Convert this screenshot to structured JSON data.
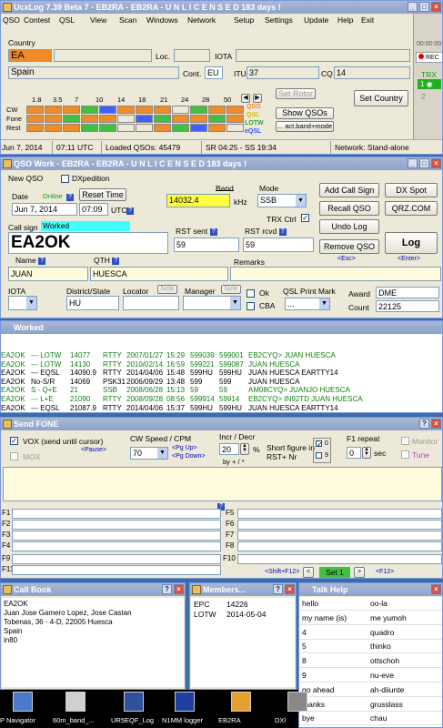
{
  "main": {
    "title": "UcxLog 7.39 Beta 7 - EB2RA - EB2RA - U N L I C E N S E D  183 days !",
    "menu": [
      "QSO",
      "Contest",
      "QSL",
      "View",
      "Scan",
      "Windows",
      "Network",
      "Setup",
      "Settings",
      "Update",
      "Help",
      "Exit"
    ],
    "country_label": "Country",
    "prefix": "EA",
    "country": "Spain",
    "loc_label": "Loc.",
    "iota_label": "IOTA",
    "cont_label": "Cont.",
    "cont": "EU",
    "itu_label": "ITU",
    "itu": "37",
    "cq_label": "CQ",
    "cq": "14",
    "bands": [
      "1.8",
      "3.5",
      "7",
      "10",
      "14",
      "18",
      "21",
      "24",
      "28",
      "50"
    ],
    "modes": [
      "CW",
      "Fone",
      "Rest"
    ],
    "legend": [
      "QSO",
      "QSL",
      "LOTW",
      "eQSL"
    ],
    "set_rotor": "Set Rotor",
    "show_qsos": "Show QSOs",
    "act_band_mode": "... act.band+mode",
    "set_country": "Set Country",
    "rec": "REC",
    "clock": "00:00:00",
    "trx_label": "TRX",
    "trx1": "1",
    "trx2": "2",
    "status": {
      "date": "Jun 7, 2014",
      "utc": "07:11 UTC",
      "loaded": "Loaded QSOs: 45479",
      "sr": "SR 04:25 - SS 19:34",
      "network": "Network: Stand-alone"
    }
  },
  "qso": {
    "title": "QSO Work - EB2RA - EB2RA - U N L I C E N S E D  183 days !",
    "new_qso": "New QSO",
    "dxpedition": "DXpedition",
    "date_label": "Date",
    "online": "Online",
    "reset_time": "Reset Time",
    "date": "Jun 7, 2014",
    "time": "07:09",
    "utc": "UTC",
    "band_label": "Band",
    "freq": "14032.4",
    "khz": "kHz",
    "mode_label": "Mode",
    "mode": "SSB",
    "trx_ctrl": "TRX Ctrl",
    "add_call_sign": "Add Call Sign",
    "dx_spot": "DX Spot",
    "recall_qso": "Recall QSO",
    "qrz": "QRZ.COM",
    "undo_log": "Undo Log",
    "remove_qso": "Remove QSO",
    "log": "Log",
    "esc": "<Esc>",
    "enter": "<Enter>",
    "callsign_label": "Call sign",
    "worked": "Worked",
    "callsign": "EA2OK",
    "rst_sent_label": "RST sent",
    "rst_sent": "59",
    "rst_rcvd_label": "RST rcvd",
    "rst_rcvd": "59",
    "name_label": "Name",
    "name": "JUAN",
    "qth_label": "QTH",
    "qth": "HUESCA",
    "remarks_label": "Remarks",
    "iota_label": "IOTA",
    "district_label": "District/State",
    "district": "HU",
    "locator_label": "Locator",
    "note": "Note",
    "manager_label": "Manager",
    "ok": "Ok",
    "cba": "CBA",
    "qsl_mark_label": "QSL Print Mark",
    "qsl_mark": "...",
    "award_label": "Award",
    "award": "DME",
    "count_label": "Count",
    "count": "22125"
  },
  "worked": {
    "title": "Worked",
    "rows": [
      [
        "EA2OK",
        "--- LOTW",
        "14077",
        "RTTY",
        "2007/01/27",
        "15:29",
        "599039",
        "599001",
        "EB2CYQ> JUAN HUESCA",
        "g"
      ],
      [
        "EA2OK",
        "--- LOTW",
        "14130",
        "RTTY",
        "2010/02/14",
        "16:59",
        "599221",
        "599087",
        "JUAN HUESCA",
        "g"
      ],
      [
        "EA2OK",
        "--- EQSL",
        "14090.9",
        "RTTY",
        "2014/04/06",
        "15:48",
        "599HU",
        "599HU",
        "JUAN HUESCA EARTTY14",
        "k"
      ],
      [
        "EA2OK",
        "No-S/R",
        "14069",
        "PSK31",
        "2006/09/29",
        "13:48",
        "599",
        "599",
        "JUAN HUESCA",
        "k"
      ],
      [
        "EA2OK",
        "S - Q+E",
        "21",
        "SSB",
        "2008/06/28",
        "15:13",
        "59",
        "59",
        "AM08CYQ> JUANJO HUESCA",
        "g"
      ],
      [
        "EA2OK",
        "--- L+E",
        "21090",
        "RTTY",
        "2008/09/28",
        "08:56",
        "599914",
        "59914",
        "EB2CYQ> IN92TD JUAN HUESCA",
        "g"
      ],
      [
        "EA2OK",
        "--- EQSL",
        "21087.9",
        "RTTY",
        "2014/04/06",
        "15:37",
        "599HU",
        "599HU",
        "JUAN HUESCA EARTTY14",
        "k"
      ]
    ]
  },
  "fone": {
    "title": "Send FONE",
    "vox": "VOX (send until cursor)",
    "pause": "<Pause>",
    "mox": "MOX",
    "cw_speed_label": "CW Speed / CPM",
    "cw_speed": "70",
    "pgup": "<Pg Up>",
    "pgdn": "<Pg Down>",
    "incr_label": "Incr / Decr",
    "incr": "20",
    "pct": "%",
    "by": "by + / *",
    "short_label": "Short figure in RST+ Nr",
    "f1_repeat_label": "F1 repeat",
    "f1_repeat": "0",
    "sec": "sec",
    "monitor": "Monitor",
    "tune": "Tune",
    "fkeys_left": [
      "F1",
      "F2",
      "F3",
      "F4",
      "F9",
      "F11"
    ],
    "fkeys_right": [
      "F5",
      "F6",
      "F7",
      "F8",
      "F10"
    ],
    "shift_f12": "<Shift+F12>",
    "set": "Set 1",
    "f12": "<F12>"
  },
  "callbook": {
    "title": "Call Book",
    "lines": [
      "EA2OK",
      "Juan Jose Gamero Lopez, Jose Castan",
      "Tobenas, 36 - 4-D, 22005 Huesca",
      "Spain",
      "in80"
    ]
  },
  "members": {
    "title": "Members...",
    "rows": [
      [
        "EPC",
        "14226"
      ],
      [
        "LOTW",
        "2014-05-04"
      ]
    ]
  },
  "talk": {
    "title": "Talk Help",
    "rows": [
      [
        "hello",
        "oo-la"
      ],
      [
        "my name (is)",
        "me yumoh"
      ],
      [
        "4",
        "quadro"
      ],
      [
        "5",
        "thinko"
      ],
      [
        "8",
        "ottschoh"
      ],
      [
        "9",
        "nu-eve"
      ],
      [
        "go ahead",
        "ah-diiunte"
      ],
      [
        "thanks",
        "grusslass"
      ],
      [
        "bye",
        "chau"
      ]
    ]
  },
  "taskbar": [
    "P Navigator",
    "60m_band_...",
    "UR5EQF_Log",
    "N1MM logger",
    "EB2RA",
    "DXl"
  ],
  "colors": {
    "title_bg": "#8ea3c9",
    "prefix_bg": "#f08c28",
    "freq_bg": "#ffff40",
    "worked_bg": "#40ffff",
    "set_bg": "#40c040",
    "legend_qso": "#f08c28",
    "legend_qsl": "#f0f000",
    "legend_lotw": "#40c040",
    "legend_eqsl": "#4060ff"
  }
}
